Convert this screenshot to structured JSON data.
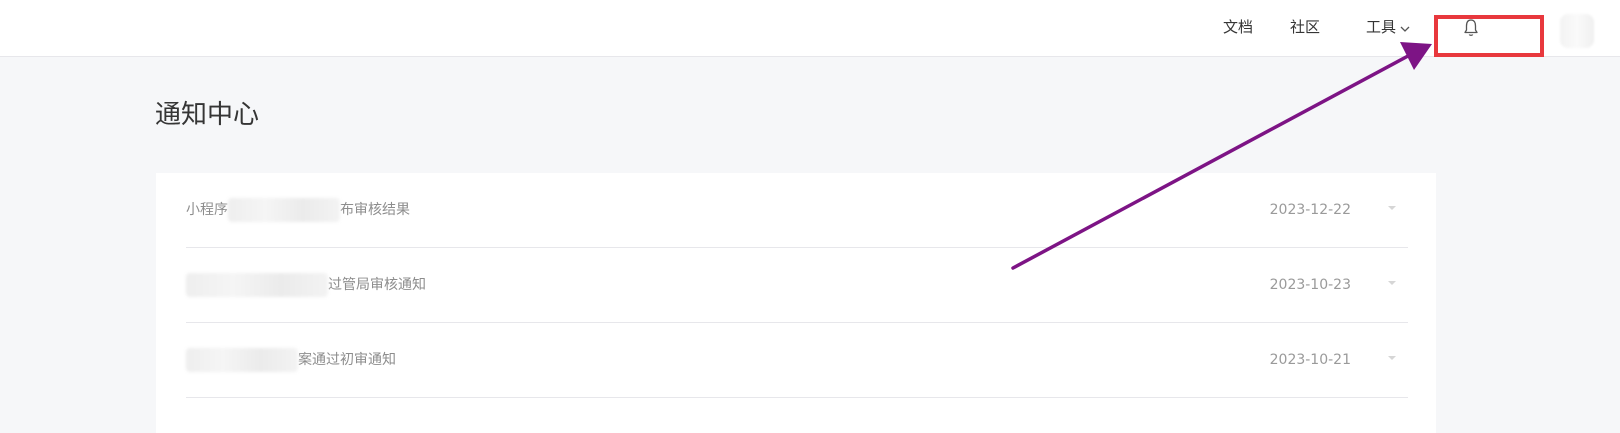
{
  "header": {
    "docs_label": "文档",
    "community_label": "社区",
    "tools_label": "工具"
  },
  "page": {
    "title": "通知中心"
  },
  "notifications": [
    {
      "title_prefix": "小程序",
      "title_suffix": "布审核结果",
      "date": "2023-12-22"
    },
    {
      "title_prefix": "",
      "title_suffix": "过管局审核通知",
      "date": "2023-10-23"
    },
    {
      "title_prefix": "",
      "title_suffix": "案通过初审通知",
      "date": "2023-10-21"
    }
  ],
  "icons": {
    "bell": "bell-icon",
    "tools_dropdown": "chevron-down-icon",
    "row_expand": "caret-down-icon"
  },
  "colors": {
    "annotation_box": "#e8383d",
    "annotation_arrow": "#7d1485",
    "background": "#f6f7f9"
  }
}
